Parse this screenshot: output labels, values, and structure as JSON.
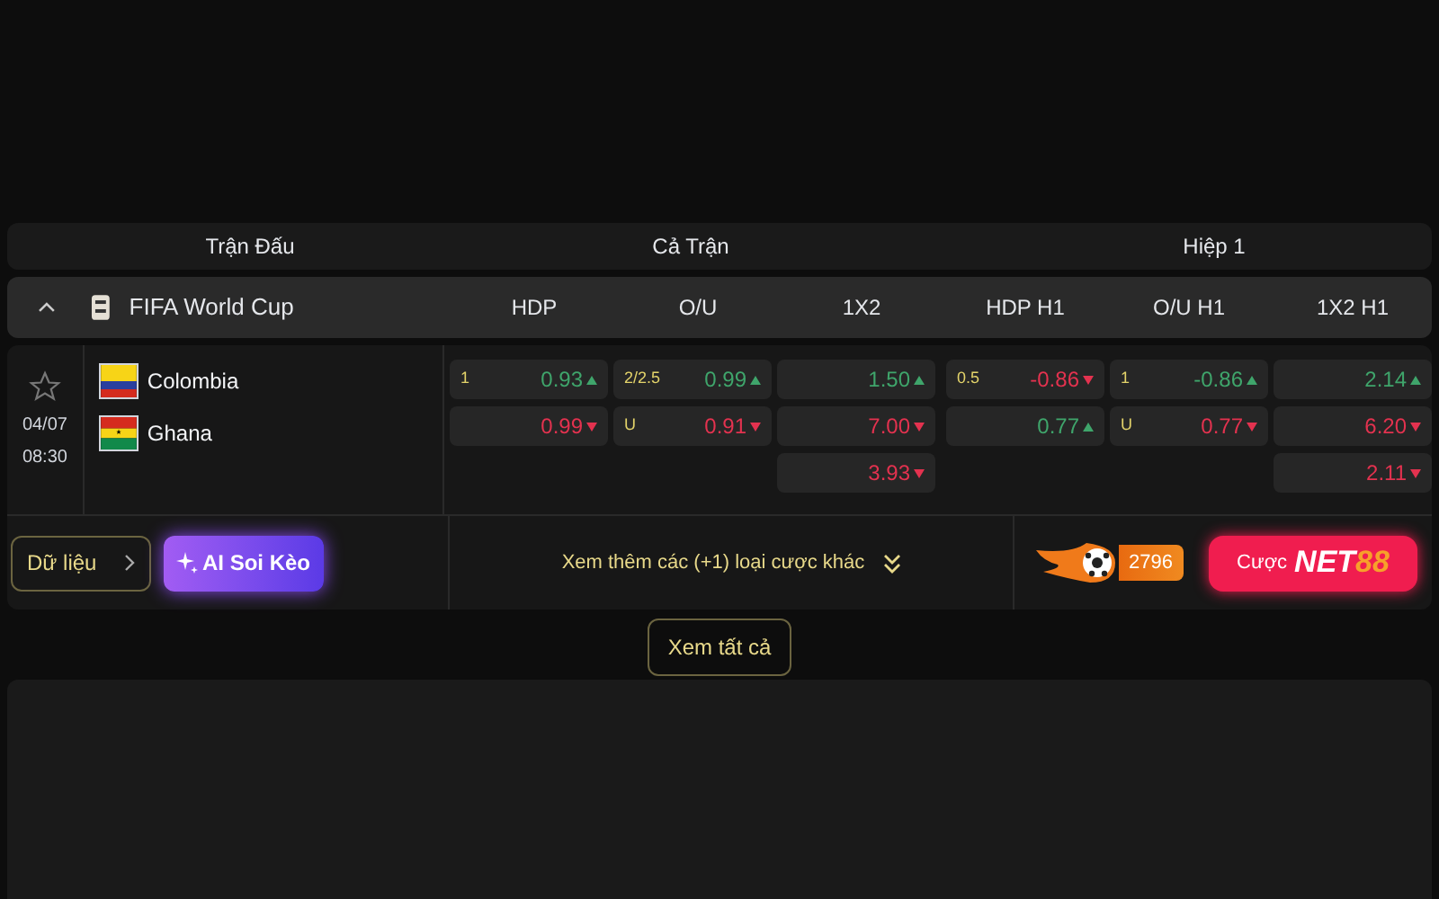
{
  "header": {
    "match_col": "Trận Đấu",
    "full_time": "Cả Trận",
    "first_half": "Hiệp 1"
  },
  "league": {
    "name": "FIFA World Cup",
    "expanded": true,
    "markets": [
      "HDP",
      "O/U",
      "1X2",
      "HDP H1",
      "O/U H1",
      "1X2 H1"
    ]
  },
  "match": {
    "favorite": false,
    "date": "04/07",
    "time": "08:30",
    "teams": [
      {
        "name": "Colombia",
        "kind": "colombia"
      },
      {
        "name": "Ghana",
        "kind": "ghana"
      }
    ],
    "odds": [
      [
        {
          "label": "1",
          "value": "0.93",
          "rising": true
        },
        {
          "value": "0.99",
          "rising": false
        }
      ],
      [
        {
          "label": "2/2.5",
          "value": "0.99",
          "rising": true
        },
        {
          "label": "U",
          "value": "0.91",
          "rising": false
        }
      ],
      [
        {
          "value": "1.50",
          "rising": true
        },
        {
          "value": "7.00",
          "rising": false
        },
        {
          "value": "3.93",
          "rising": false
        }
      ],
      [
        {
          "label": "0.5",
          "value": "-0.86",
          "rising": false
        },
        {
          "value": "0.77",
          "rising": true
        }
      ],
      [
        {
          "label": "1",
          "value": "-0.86",
          "rising": true
        },
        {
          "label": "U",
          "value": "0.77",
          "rising": false
        }
      ],
      [
        {
          "value": "2.14",
          "rising": true
        },
        {
          "value": "6.20",
          "rising": false
        },
        {
          "value": "2.11",
          "rising": false
        }
      ]
    ]
  },
  "footer": {
    "data_button": "Dữ liệu",
    "ai_button": "AI Soi Kèo",
    "more_bets": "Xem thêm các (+1) loại cược khác",
    "hot_count": "2796",
    "bet_button": "Cược",
    "brand_main": "NET",
    "brand_accent": "88"
  },
  "view_all": "Xem tất cả"
}
